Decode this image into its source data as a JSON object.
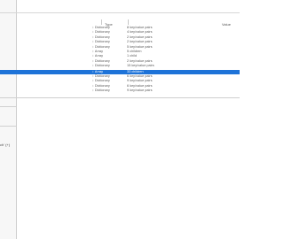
{
  "columns": {
    "type": "Type",
    "value": "Value"
  },
  "rows": [
    {
      "type": "Dictionary",
      "value": "8 key/value pairs"
    },
    {
      "type": "Dictionary",
      "value": "4 key/value pairs"
    },
    {
      "type": "Dictionary",
      "value": "2 key/value pairs"
    },
    {
      "type": "Dictionary",
      "value": "2 key/value pairs"
    },
    {
      "type": "Dictionary",
      "value": "5 key/value pairs"
    },
    {
      "type": "Array",
      "value": "5 children"
    },
    {
      "type": "Array",
      "value": "1 child"
    },
    {
      "type": "Dictionary",
      "value": "2 key/value pairs"
    },
    {
      "type": "Dictionary",
      "value": "15 key/value pairs"
    },
    {
      "type": "Array",
      "value": "33 children",
      "selected": true
    },
    {
      "type": "Dictionary",
      "value": "6 key/value pairs"
    },
    {
      "type": "Dictionary",
      "value": "9 key/value pairs"
    },
    {
      "type": "Dictionary",
      "value": "6 key/value pairs"
    },
    {
      "type": "Dictionary",
      "value": "9 key/value pairs"
    }
  ],
  "left_menu": {
    "hint_1": "ch' (+)",
    "hint_2": ""
  },
  "colors": {
    "selection": "#1e73d8"
  }
}
